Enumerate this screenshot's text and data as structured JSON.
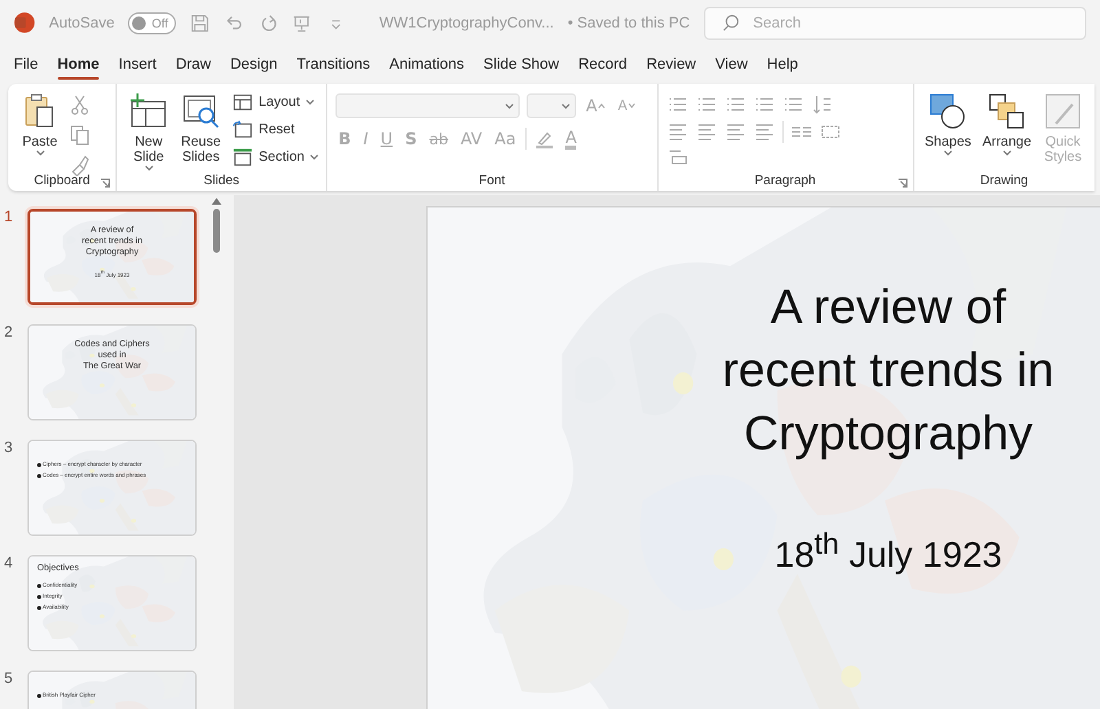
{
  "titlebar": {
    "autosave_label": "AutoSave",
    "autosave": {
      "on": false,
      "label": "Off"
    },
    "document_title": "WW1CryptographyConv...",
    "save_status": "• Saved to this PC",
    "search": {
      "placeholder": "Search"
    }
  },
  "tabs": [
    {
      "label": "File",
      "selected": false
    },
    {
      "label": "Home",
      "selected": true
    },
    {
      "label": "Insert",
      "selected": false
    },
    {
      "label": "Draw",
      "selected": false
    },
    {
      "label": "Design",
      "selected": false
    },
    {
      "label": "Transitions",
      "selected": false
    },
    {
      "label": "Animations",
      "selected": false
    },
    {
      "label": "Slide Show",
      "selected": false
    },
    {
      "label": "Record",
      "selected": false
    },
    {
      "label": "Review",
      "selected": false
    },
    {
      "label": "View",
      "selected": false
    },
    {
      "label": "Help",
      "selected": false
    }
  ],
  "ribbon": {
    "clipboard": {
      "label": "Clipboard",
      "paste": "Paste"
    },
    "slides": {
      "label": "Slides",
      "new_slide": "New Slide",
      "reuse_slides": "Reuse Slides",
      "layout": "Layout",
      "reset": "Reset",
      "section": "Section"
    },
    "font": {
      "label": "Font",
      "grow": "A",
      "shrink": "A",
      "format_buttons": [
        "B",
        "I",
        "U",
        "S",
        "ab",
        "AV",
        "Aa"
      ],
      "font_color": "A"
    },
    "paragraph": {
      "label": "Paragraph"
    },
    "drawing": {
      "label": "Drawing",
      "shapes": "Shapes",
      "arrange": "Arrange",
      "quick_styles": "Quick Styles"
    }
  },
  "slides": [
    {
      "number": "1",
      "selected": true,
      "kind": "title",
      "lines": [
        "A review of",
        "recent trends in",
        "Cryptography"
      ],
      "subtitle": "18$^{th}$ July 1923"
    },
    {
      "number": "2",
      "selected": false,
      "kind": "title",
      "lines": [
        "Codes and Ciphers",
        "used in",
        "The Great War"
      ]
    },
    {
      "number": "3",
      "selected": false,
      "kind": "bullets",
      "bullets": [
        "Ciphers – encrypt character by character",
        "Codes –  encrypt entire words and phrases"
      ]
    },
    {
      "number": "4",
      "selected": false,
      "kind": "bullets",
      "heading": "Objectives",
      "bullets": [
        "Confidentiality",
        "Integrity",
        "Availability"
      ]
    },
    {
      "number": "5",
      "selected": false,
      "kind": "bullets",
      "bullets": [
        "British Playfair Cipher"
      ]
    }
  ],
  "editor": {
    "title_lines": [
      "A review of",
      "recent trends in",
      "Cryptography"
    ],
    "subtitle": "18$^{th}$ July 1923"
  }
}
